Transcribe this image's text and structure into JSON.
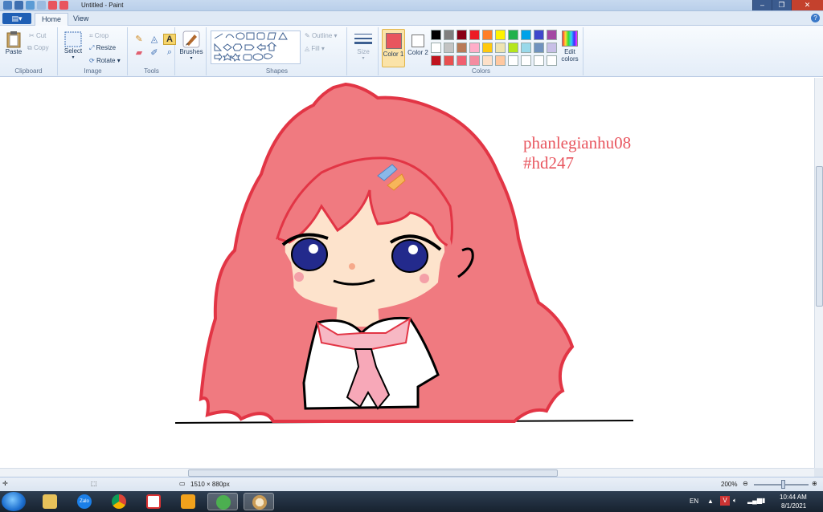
{
  "window": {
    "title": "Untitled - Paint"
  },
  "tabs": {
    "file": "",
    "home": "Home",
    "view": "View"
  },
  "ribbon": {
    "clipboard": {
      "paste": "Paste",
      "cut": "Cut",
      "copy": "Copy",
      "label": "Clipboard"
    },
    "image": {
      "select": "Select",
      "crop": "Crop",
      "resize": "Resize",
      "rotate": "Rotate",
      "label": "Image"
    },
    "tools": {
      "label": "Tools"
    },
    "brushes": {
      "label": "Brushes"
    },
    "shapes": {
      "outline": "Outline",
      "fill": "Fill",
      "label": "Shapes"
    },
    "size": {
      "label": "Size"
    },
    "colors": {
      "color1": "Color 1",
      "color2": "Color 2",
      "edit": "Edit colors",
      "label": "Colors",
      "color1_value": "#e8555e",
      "color2_value": "#ffffff",
      "palette": [
        "#000000",
        "#7f7f7f",
        "#880015",
        "#ed1c24",
        "#ff7f27",
        "#fff200",
        "#22b14c",
        "#00a2e8",
        "#3f48cc",
        "#a349a4",
        "#ffffff",
        "#c3c3c3",
        "#b97a57",
        "#ffaec9",
        "#ffc90e",
        "#efe4b0",
        "#b5e61d",
        "#99d9ea",
        "#7092be",
        "#c8bfe7",
        "#c0141e",
        "#e85050",
        "#f06070",
        "#f48ca0",
        "#fde0c8",
        "#ffc8a0",
        "#ffffff",
        "#ffffff",
        "#ffffff",
        "#ffffff"
      ]
    }
  },
  "canvas": {
    "signature_line1": "phanlegianhu08",
    "signature_line2": "#hd247",
    "text_color": "#e8555e"
  },
  "status": {
    "dimensions": "1510 × 880px",
    "zoom": "200%"
  },
  "taskbar": {
    "apps": [
      "start",
      "file-explorer",
      "zalo",
      "chrome",
      "app-4",
      "app-5",
      "app-6",
      "paint"
    ],
    "zalo_label": "Zalo",
    "lang": "EN",
    "time": "10:44 AM",
    "date": "8/1/2021"
  }
}
